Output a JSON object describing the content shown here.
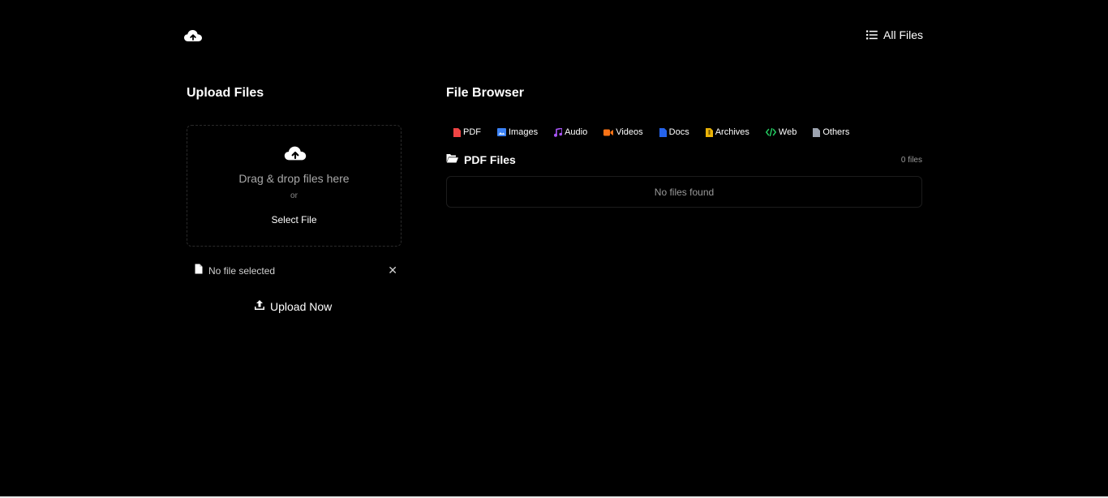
{
  "header": {
    "logo_icon": "cloud-upload-icon",
    "all_files_label": "All Files",
    "all_files_icon": "list-icon"
  },
  "upload": {
    "title": "Upload Files",
    "dropzone_icon": "cloud-upload-icon",
    "dropzone_text": "Drag & drop files here",
    "or_text": "or",
    "select_label": "Select File",
    "file_status": "No file selected",
    "clear_label": "✕",
    "upload_button_label": "Upload Now"
  },
  "browser": {
    "title": "File Browser",
    "tabs": [
      {
        "label": "PDF",
        "icon": "pdf-icon",
        "color": "#ef4444"
      },
      {
        "label": "Images",
        "icon": "image-icon",
        "color": "#3b82f6"
      },
      {
        "label": "Audio",
        "icon": "music-icon",
        "color": "#a855f7"
      },
      {
        "label": "Videos",
        "icon": "video-icon",
        "color": "#f97316"
      },
      {
        "label": "Docs",
        "icon": "document-icon",
        "color": "#2563eb"
      },
      {
        "label": "Archives",
        "icon": "archive-icon",
        "color": "#eab308"
      },
      {
        "label": "Web",
        "icon": "code-icon",
        "color": "#22c55e"
      },
      {
        "label": "Others",
        "icon": "file-icon",
        "color": "#9ca3af"
      }
    ],
    "section_title": "PDF Files",
    "section_icon": "folder-open-icon",
    "file_count": "0 files",
    "empty_message": "No files found"
  }
}
